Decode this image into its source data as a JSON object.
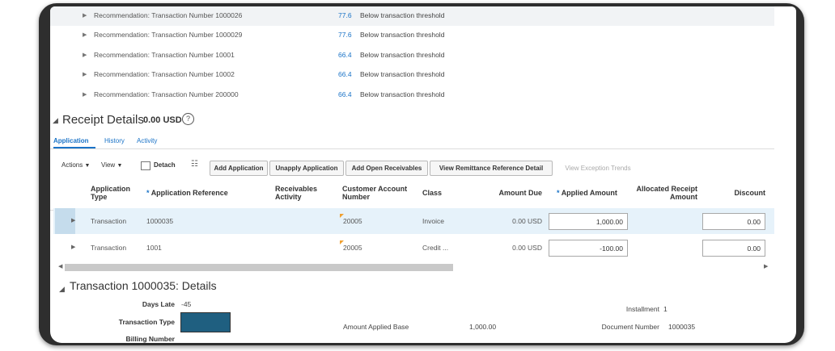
{
  "recommendations": [
    {
      "label": "Recommendation: Transaction Number 1000026",
      "score": "77.6",
      "reason": "Below transaction threshold"
    },
    {
      "label": "Recommendation: Transaction Number 1000029",
      "score": "77.6",
      "reason": "Below transaction threshold"
    },
    {
      "label": "Recommendation: Transaction Number 10001",
      "score": "66.4",
      "reason": "Below transaction threshold"
    },
    {
      "label": "Recommendation: Transaction Number 10002",
      "score": "66.4",
      "reason": "Below transaction threshold"
    },
    {
      "label": "Recommendation: Transaction Number 200000",
      "score": "66.4",
      "reason": "Below transaction threshold"
    }
  ],
  "receipt_details": {
    "title": "Receipt Details",
    "amount": "0.00 USD",
    "help_icon": "question-circle-icon"
  },
  "tabs": [
    {
      "label": "Application",
      "active": true
    },
    {
      "label": "History"
    },
    {
      "label": "Activity"
    }
  ],
  "toolbar": {
    "actions": "Actions",
    "view": "View",
    "detach": "Detach",
    "add_application": "Add Application",
    "unapply_application": "Unapply Application",
    "add_open_receivables": "Add Open Receivables",
    "view_remittance": "View Remittance Reference Detail",
    "view_exception_trends": "View Exception Trends"
  },
  "columns": {
    "application_type": "Application Type",
    "application_reference": "Application Reference",
    "receivables_activity": "Receivables Activity",
    "customer_account_number": "Customer Account Number",
    "class": "Class",
    "amount_due": "Amount Due",
    "applied_amount": "Applied Amount",
    "allocated_receipt_amount": "Allocated Receipt Amount",
    "discount": "Discount",
    "required_marker": "*"
  },
  "rows": [
    {
      "type": "Transaction",
      "reference": "1000035",
      "account": "20005",
      "class": "Invoice",
      "amount_due": "0.00 USD",
      "applied": "1,000.00",
      "discount": "0.00"
    },
    {
      "type": "Transaction",
      "reference": "1001",
      "account": "20005",
      "class": "Credit ...",
      "amount_due": "0.00 USD",
      "applied": "-100.00",
      "discount": "0.00"
    }
  ],
  "transaction_details": {
    "title": "Transaction 1000035: Details",
    "days_late_label": "Days Late",
    "days_late": "-45",
    "transaction_type_label": "Transaction Type",
    "billing_number_label": "Billing Number",
    "amount_applied_base_label": "Amount Applied Base",
    "amount_applied_base": "1,000.00",
    "installment_label": "Installment",
    "installment": "1",
    "document_number_label": "Document Number",
    "document_number": "1000035"
  },
  "colors": {
    "accent": "#1a73c7",
    "selected_row": "#e6f2fa",
    "frame": "#2e2e2e",
    "transaction_type_fill": "#1f5f80"
  }
}
